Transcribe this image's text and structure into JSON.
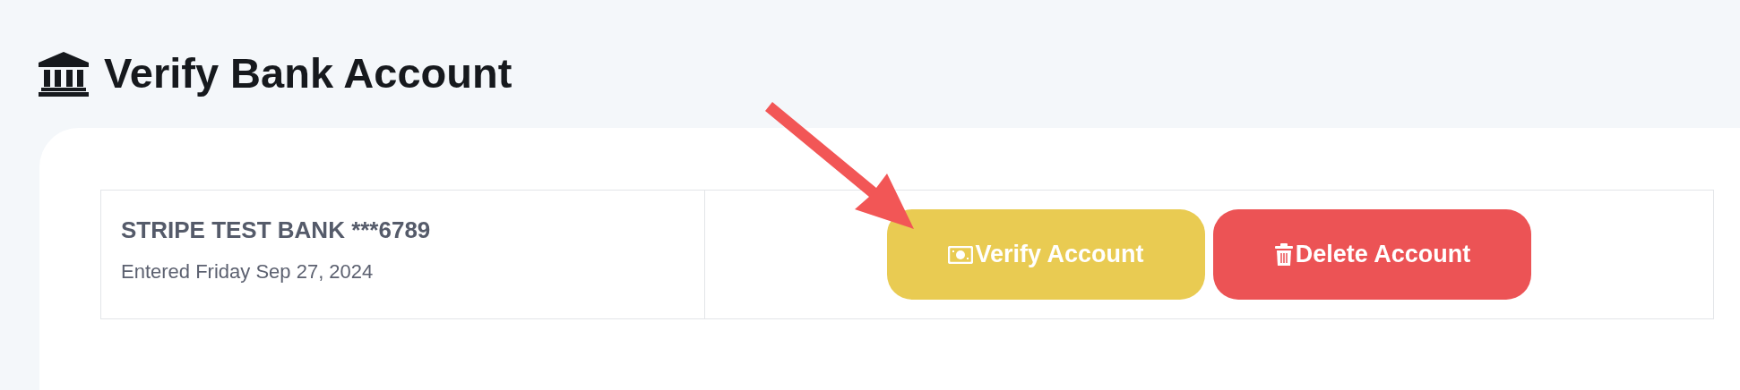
{
  "page": {
    "title": "Verify Bank Account"
  },
  "accounts": [
    {
      "name": "STRIPE TEST BANK ***6789",
      "entered": "Entered Friday Sep 27, 2024",
      "actions": [
        {
          "label": "Verify Account",
          "kind": "verify"
        },
        {
          "label": "Delete Account",
          "kind": "delete"
        }
      ]
    }
  ]
}
